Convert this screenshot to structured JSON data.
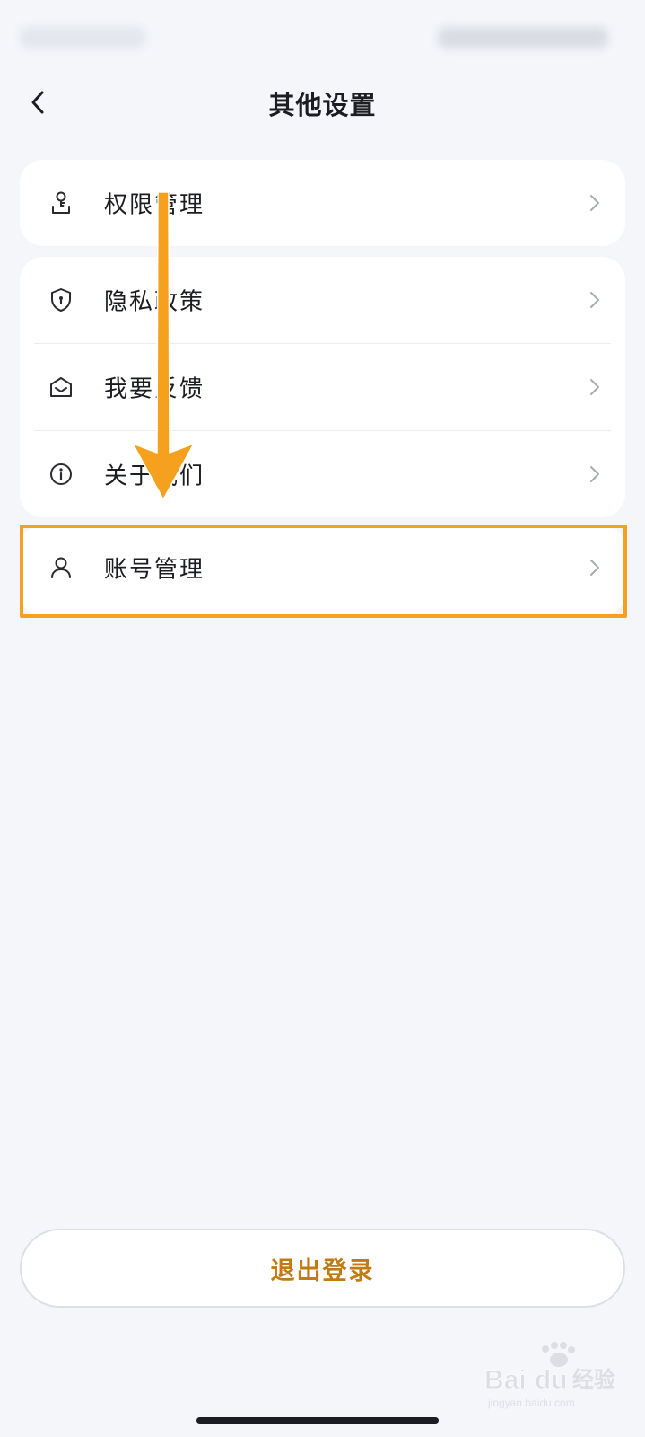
{
  "header": {
    "title": "其他设置",
    "back_icon": "chevron-left-icon"
  },
  "menu": {
    "group1": [
      {
        "label": "权限管理",
        "icon": "permission-icon"
      }
    ],
    "group2": [
      {
        "label": "隐私政策",
        "icon": "shield-icon"
      },
      {
        "label": "我要反馈",
        "icon": "envelope-icon"
      },
      {
        "label": "关于我们",
        "icon": "info-icon"
      }
    ],
    "group3": [
      {
        "label": "账号管理",
        "icon": "user-icon"
      }
    ]
  },
  "logout": {
    "label": "退出登录"
  },
  "colors": {
    "background": "#f4f6fa",
    "card": "#ffffff",
    "highlight": "#f5a11d",
    "logout_text": "#c27a12"
  }
}
